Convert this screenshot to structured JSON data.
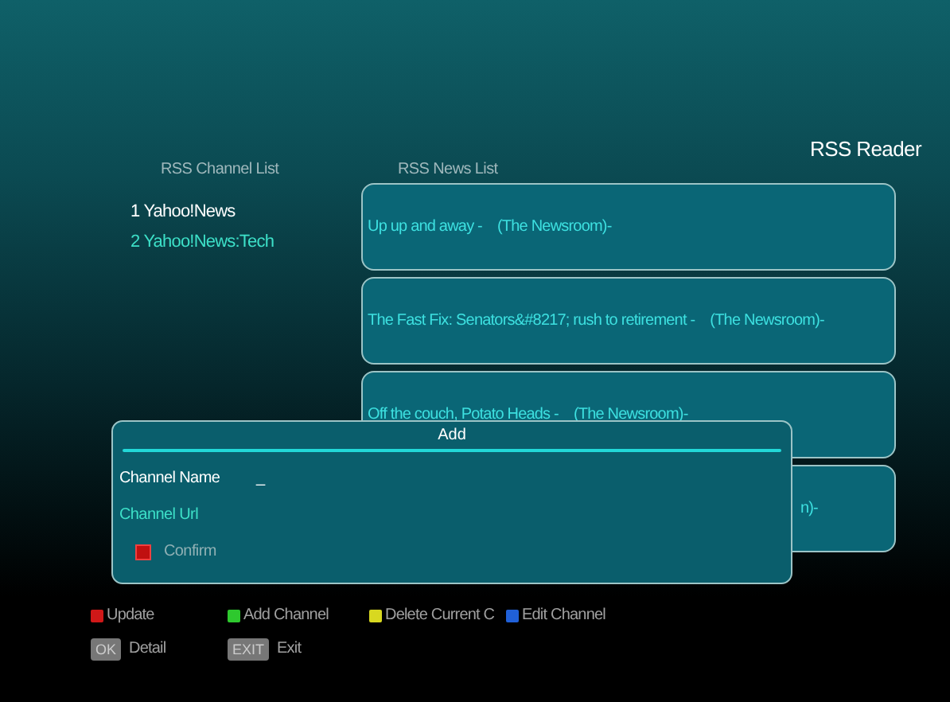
{
  "header": {
    "title": "RSS Reader"
  },
  "channel_list": {
    "heading": "RSS Channel List",
    "items": [
      {
        "number": "1",
        "name": "Yahoo!News",
        "selected": false
      },
      {
        "number": "2",
        "name": "Yahoo!News:Tech",
        "selected": true
      }
    ]
  },
  "news_list": {
    "heading": "RSS News List",
    "items": [
      {
        "text": "Up up and away -    (The Newsroom)-",
        "kind": "full"
      },
      {
        "text": "The Fast Fix: Senators&#8217; rush to retirement -    (The Newsroom)-",
        "kind": "full"
      },
      {
        "text": "Off the couch, Potato Heads -    (The Newsroom)-",
        "kind": "full"
      },
      {
        "text": "n)-",
        "kind": "tail"
      }
    ]
  },
  "dialog": {
    "title": "Add",
    "rows": [
      {
        "kind": "field",
        "label": "Channel Name",
        "value": "_",
        "selected": false
      },
      {
        "kind": "field",
        "label": "Channel Url",
        "selected": true
      },
      {
        "kind": "button",
        "label": "Confirm",
        "selected": false
      }
    ]
  },
  "legend": [
    [
      {
        "kind": "color",
        "color": "#d01818",
        "label": "Update"
      },
      {
        "kind": "color",
        "color": "#2ec82e",
        "label": "Add Channel"
      },
      {
        "kind": "color",
        "color": "#d8d820",
        "label": "Delete Current C"
      },
      {
        "kind": "color",
        "color": "#2060d8",
        "label": "Edit Channel"
      }
    ],
    [
      {
        "kind": "key",
        "key": "OK",
        "label": "Detail"
      },
      {
        "kind": "key",
        "key": "EXIT",
        "label": "Exit"
      }
    ]
  ]
}
